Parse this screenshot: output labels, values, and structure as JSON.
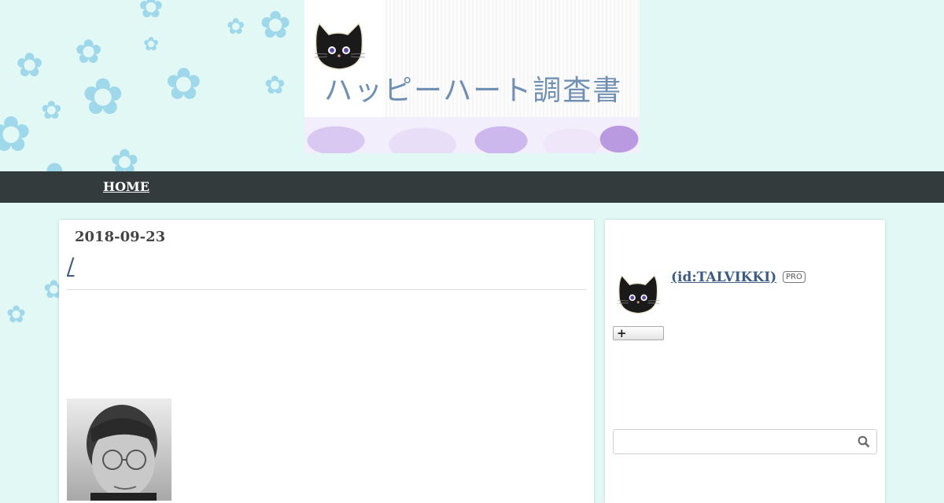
{
  "header": {
    "site_title": "ハッピーハート調査書",
    "logo_icon": "black-cat-icon"
  },
  "nav": {
    "home_label": "HOME"
  },
  "entry": {
    "date": "2018-09-23",
    "title": "/",
    "image": "portrait-photo"
  },
  "sidebar": {
    "profile": {
      "name": " (id:TALVIKKI)",
      "badge": "PRO",
      "icon": "black-cat-icon"
    },
    "follow_button": {
      "icon": "plus-icon"
    },
    "search": {
      "value": "",
      "icon": "search-icon"
    }
  },
  "colors": {
    "page_background": "#e2f8f4",
    "nav_background": "#333b3d",
    "title_text": "#6f8fb3",
    "link_text": "#3d5c80"
  }
}
